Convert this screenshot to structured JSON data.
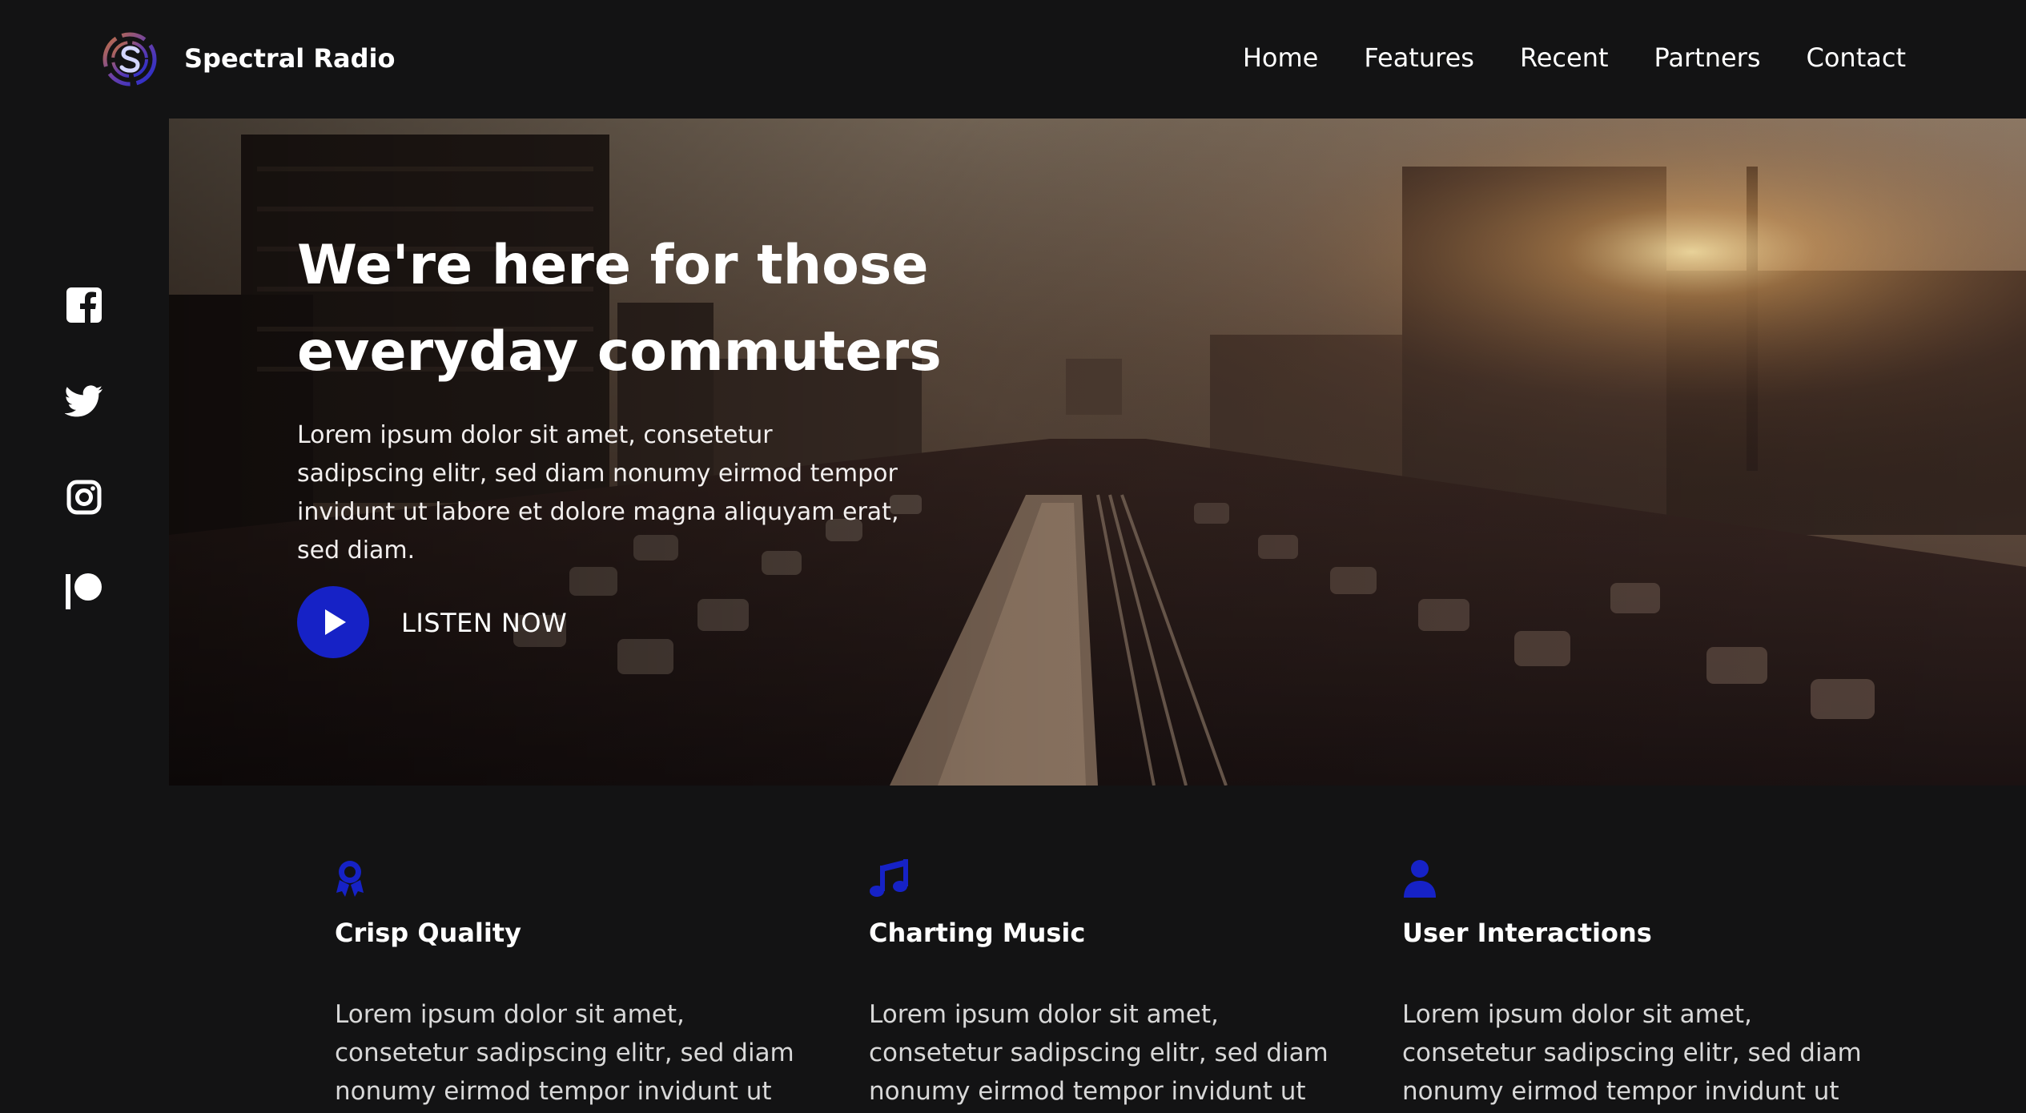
{
  "header": {
    "brand": "Spectral Radio",
    "nav": [
      "Home",
      "Features",
      "Recent",
      "Partners",
      "Contact"
    ]
  },
  "social": [
    "facebook-icon",
    "twitter-icon",
    "instagram-icon",
    "patreon-icon"
  ],
  "hero": {
    "title_line1": "We're here for those",
    "title_line2": "everyday commuters",
    "text": "Lorem ipsum dolor sit amet, consetetur sadipscing elitr, sed diam nonumy eirmod tempor invidunt ut labore et dolore magna aliquyam erat, sed diam.",
    "cta": "LISTEN NOW"
  },
  "features": [
    {
      "icon": "award-icon",
      "title": "Crisp Quality",
      "text": "Lorem ipsum dolor sit amet, consetetur sadipscing elitr, sed diam nonumy eirmod tempor invidunt ut labore et."
    },
    {
      "icon": "music-note-icon",
      "title": "Charting Music",
      "text": "Lorem ipsum dolor sit amet, consetetur sadipscing elitr, sed diam nonumy eirmod tempor invidunt ut labore et."
    },
    {
      "icon": "user-icon",
      "title": "User Interactions",
      "text": "Lorem ipsum dolor sit amet, consetetur sadipscing elitr, sed diam nonumy eirmod tempor invidunt ut labore et."
    }
  ],
  "colors": {
    "accent": "#1622c6",
    "background": "#131314"
  }
}
